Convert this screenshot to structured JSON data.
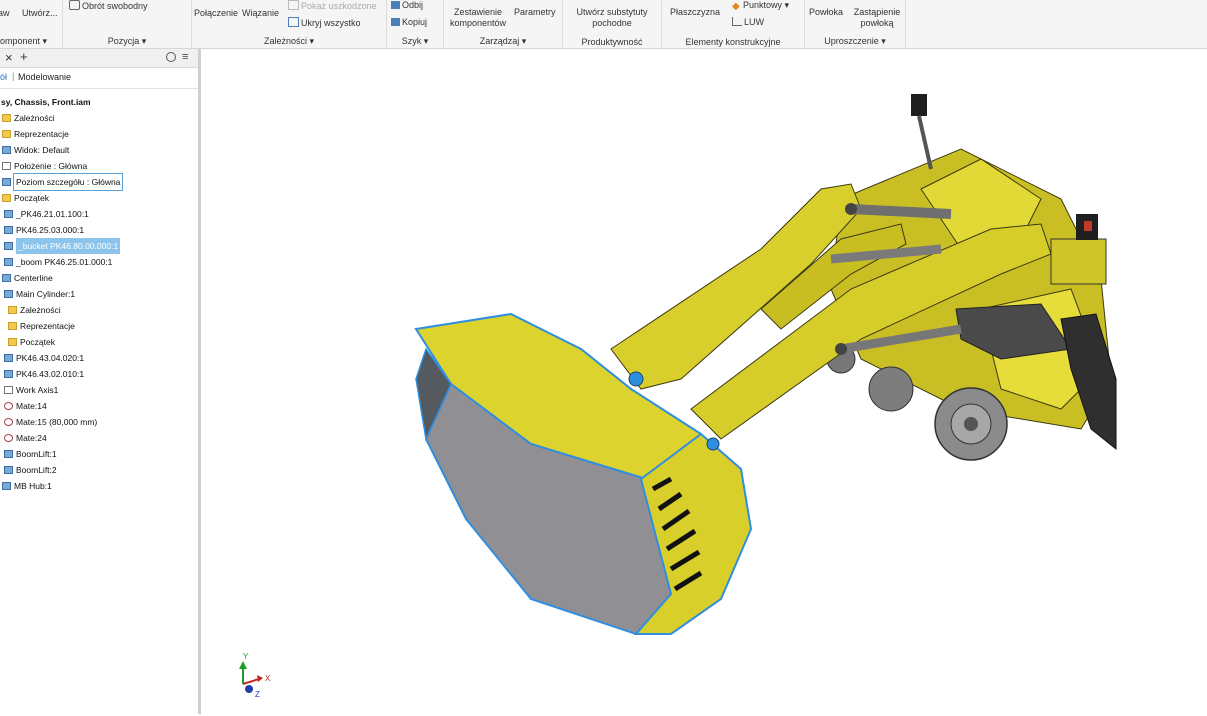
{
  "ribbon": {
    "groups": [
      {
        "label": "omponent ▾",
        "buttons": [
          "aw",
          "Utwórz..."
        ]
      },
      {
        "label": "Pozycja ▾",
        "buttons": [
          "Obrót swobodny"
        ]
      },
      {
        "label": "Zależności ▾",
        "buttons": [
          "Połączenie",
          "Wiązanie",
          "Pokaż uszkodzone",
          "Ukryj wszystko"
        ]
      },
      {
        "label": "Szyk ▾",
        "buttons": [
          "Odbij",
          "Kopiuj"
        ]
      },
      {
        "label": "Zarządzaj ▾",
        "buttons": [
          "Zestawienie komponentów",
          "Parametry"
        ]
      },
      {
        "label": "Produktywność",
        "buttons": [
          "Utwórz substytuty pochodne"
        ]
      },
      {
        "label": "Elementy konstrukcyjne",
        "buttons": [
          "Płaszczyzna",
          "Punktowy",
          "LUW"
        ]
      },
      {
        "label": "Uproszczenie ▾",
        "buttons": [
          "Powłoka",
          "Zastąpienie powłoką"
        ]
      }
    ]
  },
  "browser": {
    "tab_close": "×",
    "tab_add": "+",
    "subtabs": [
      "ół",
      "Modelowanie"
    ],
    "tree": [
      {
        "label": "sy, Chassis, Front.iam",
        "icon": "none",
        "bold": true
      },
      {
        "label": "Zależności",
        "icon": "folder"
      },
      {
        "label": "Reprezentacje",
        "icon": "folder"
      },
      {
        "label": "Widok: Default",
        "icon": "view"
      },
      {
        "label": "Położenie : Główna",
        "icon": "position"
      },
      {
        "label": "Poziom szczegółu : Główna",
        "icon": "lod",
        "state": "hover"
      },
      {
        "label": "Początek",
        "icon": "folder"
      },
      {
        "label": "_PK46.21.01.100:1",
        "icon": "part"
      },
      {
        "label": "PK46.25.03.000:1",
        "icon": "part"
      },
      {
        "label": "_bucket PK46.80.00.000:1",
        "icon": "part",
        "state": "selected"
      },
      {
        "label": "_boom PK46.25.01.000:1",
        "icon": "part"
      },
      {
        "label": "Centerline",
        "icon": "part"
      },
      {
        "label": "Main Cylinder:1",
        "icon": "part"
      },
      {
        "label": "Zależności",
        "icon": "folder"
      },
      {
        "label": "Reprezentacje",
        "icon": "folder"
      },
      {
        "label": "Początek",
        "icon": "folder"
      },
      {
        "label": "PK46.43.04.020:1",
        "icon": "part"
      },
      {
        "label": "PK46.43.02.010:1",
        "icon": "part"
      },
      {
        "label": "Work Axis1",
        "icon": "axis"
      },
      {
        "label": "Mate:14",
        "icon": "mate"
      },
      {
        "label": "Mate:15 (80,000 mm)",
        "icon": "mate"
      },
      {
        "label": "Mate:24",
        "icon": "mate"
      },
      {
        "label": "BoomLift:1",
        "icon": "part"
      },
      {
        "label": "BoomLift:2",
        "icon": "part"
      },
      {
        "label": "MB Hub:1",
        "icon": "part"
      }
    ]
  },
  "viewport": {
    "axis_labels": {
      "x": "X",
      "y": "Y",
      "z": "Z"
    },
    "model_color": "#d7cd2a",
    "selection_color": "#2f8ee0"
  }
}
